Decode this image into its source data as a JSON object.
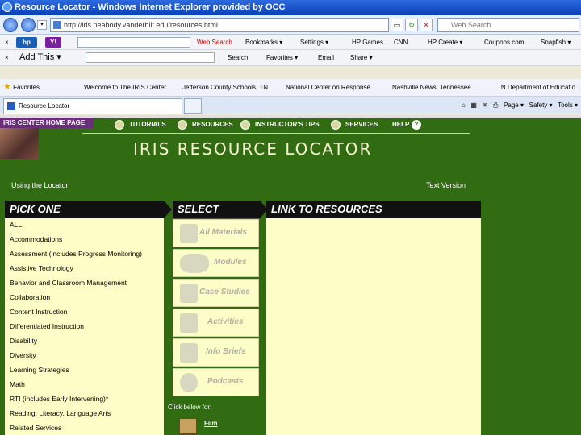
{
  "window": {
    "title": "Resource Locator - Windows Internet Explorer provided by OCC"
  },
  "address": {
    "url": "http://iris.peabody.vanderbilt.edu/resources.html",
    "search_placeholder": "Web Search"
  },
  "toolbar1": {
    "close_glyph": "×",
    "hp_label": "hp",
    "yahoo_label": "Y!",
    "search_btn": "Web Search",
    "bookmarks": "Bookmarks ▾",
    "settings": "Settings ▾",
    "hp_games": "HP Games",
    "cnn": "CNN",
    "hp_create": "HP Create ▾",
    "coupons": "Coupons.com",
    "snapfish": "Snapfish ▾"
  },
  "toolbar2": {
    "close_glyph": "×",
    "add_this": "Add This ▾",
    "search": "Search",
    "favorites": "Favorites ▾",
    "email": "Email",
    "share": "Share ▾"
  },
  "favorites_bar": {
    "label": "Favorites",
    "items": [
      "Welcome to The IRIS Center",
      "Jefferson County Schools, TN",
      "National Center on Response",
      "Nashville News, Tennessee ...",
      "TN Department of Educatio..."
    ]
  },
  "tab": {
    "title": "Resource Locator"
  },
  "commands": {
    "page": "Page ▾",
    "safety": "Safety ▾",
    "tools": "Tools ▾"
  },
  "site": {
    "home_link": "IRIS CENTER HOME PAGE",
    "nav": [
      "TUTORIALS",
      "RESOURCES",
      "INSTRUCTOR'S TIPS",
      "SERVICES",
      "HELP"
    ],
    "help_q": "?",
    "title": "IRIS RESOURCE LOCATOR",
    "using_locator": "Using the Locator",
    "text_version": "Text Version"
  },
  "columns": {
    "pick_one": "PICK ONE",
    "select": "SELECT",
    "link": "LINK TO RESOURCES"
  },
  "topics": [
    "ALL",
    "Accommodations",
    "Assessment (includes Progress Monitoring)",
    "Assistive Technology",
    "Behavior and Classroom Management",
    "Collaboration",
    "Content Instruction",
    "Differentiated Instruction",
    "Disability",
    "Diversity",
    "Learning Strategies",
    "Math",
    "RTI (includes Early Intervening)*",
    "Reading, Literacy, Language Arts",
    "Related Services"
  ],
  "select_buttons": [
    "All Materials",
    "Modules",
    "Case Studies",
    "Activities",
    "Info Briefs",
    "Podcasts"
  ],
  "click_below": "Click below for:",
  "film": "Film"
}
